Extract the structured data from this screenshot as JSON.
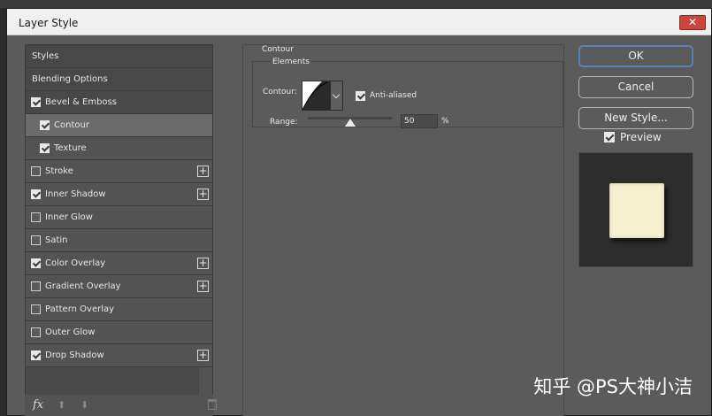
{
  "window": {
    "title": "Layer Style",
    "close_glyph": "✕"
  },
  "styles_list": [
    {
      "label": "Styles",
      "checkbox": null,
      "plus": false,
      "selected": false,
      "header": true
    },
    {
      "label": "Blending Options",
      "checkbox": null,
      "plus": false,
      "selected": false,
      "header": true
    },
    {
      "label": "Bevel & Emboss",
      "checkbox": true,
      "plus": false,
      "selected": false,
      "header": true
    },
    {
      "label": "Contour",
      "checkbox": true,
      "plus": false,
      "selected": true,
      "sub": true
    },
    {
      "label": "Texture",
      "checkbox": true,
      "plus": false,
      "selected": false,
      "sub": true
    },
    {
      "label": "Stroke",
      "checkbox": false,
      "plus": true,
      "selected": false
    },
    {
      "label": "Inner Shadow",
      "checkbox": true,
      "plus": true,
      "selected": false
    },
    {
      "label": "Inner Glow",
      "checkbox": false,
      "plus": false,
      "selected": false
    },
    {
      "label": "Satin",
      "checkbox": false,
      "plus": false,
      "selected": false
    },
    {
      "label": "Color Overlay",
      "checkbox": true,
      "plus": true,
      "selected": false
    },
    {
      "label": "Gradient Overlay",
      "checkbox": false,
      "plus": true,
      "selected": false
    },
    {
      "label": "Pattern Overlay",
      "checkbox": false,
      "plus": false,
      "selected": false
    },
    {
      "label": "Outer Glow",
      "checkbox": false,
      "plus": false,
      "selected": false
    },
    {
      "label": "Drop Shadow",
      "checkbox": true,
      "plus": true,
      "selected": false
    }
  ],
  "bottom_bar": {
    "fx_label": "fx",
    "up_glyph": "⬆",
    "down_glyph": "⬇"
  },
  "panel": {
    "group_title": "Contour",
    "fieldset_title": "Elements",
    "contour_label": "Contour:",
    "anti_aliased_label": "Anti-aliased",
    "anti_aliased": true,
    "range_label": "Range:",
    "range_value": "50",
    "range_fraction": 0.5,
    "range_unit": "%"
  },
  "buttons": {
    "ok": "OK",
    "cancel": "Cancel",
    "new_style": "New Style..."
  },
  "preview": {
    "label": "Preview",
    "checked": true,
    "swatch_color": "#f4f0d0"
  },
  "watermark": "知乎 @PS大神小洁",
  "colors": {
    "dialog_bg": "#5b5b5b",
    "ok_border": "#5d7fbd",
    "close_red": "#c9463d"
  }
}
